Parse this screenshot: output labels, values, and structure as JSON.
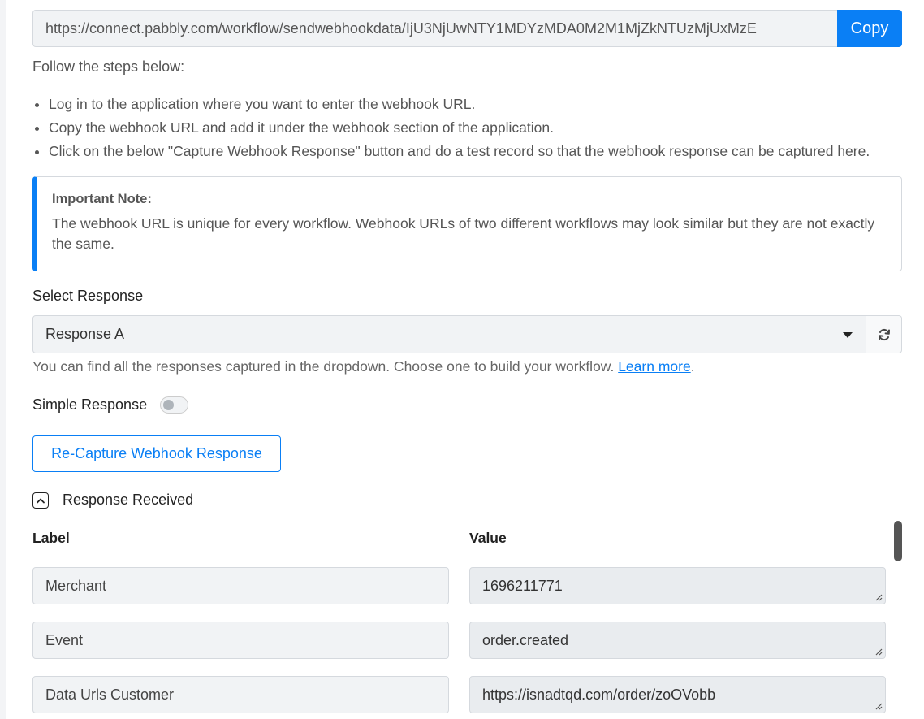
{
  "webhook": {
    "url": "https://connect.pabbly.com/workflow/sendwebhookdata/IjU3NjUwNTY1MDYzMDA0M2M1MjZkNTUzMjUxMzE",
    "copy_label": "Copy"
  },
  "steps": {
    "title": "Follow the steps below:",
    "items": [
      "Log in to the application where you want to enter the webhook URL.",
      "Copy the webhook URL and add it under the webhook section of the application.",
      "Click on the below \"Capture Webhook Response\" button and do a test record so that the webhook response can be captured here."
    ]
  },
  "note": {
    "title": "Important Note:",
    "body": "The webhook URL is unique for every workflow. Webhook URLs of two different workflows may look similar but they are not exactly the same."
  },
  "response_select": {
    "label": "Select Response",
    "selected": "Response A",
    "help_text": "You can find all the responses captured in the dropdown. Choose one to build your workflow. ",
    "learn_more": "Learn more",
    "help_suffix": "."
  },
  "simple_response": {
    "label": "Simple Response",
    "enabled": false
  },
  "recapture_label": "Re-Capture Webhook Response",
  "response_received": {
    "title": "Response Received",
    "label_header": "Label",
    "value_header": "Value",
    "rows": [
      {
        "label": "Merchant",
        "value": "1696211771"
      },
      {
        "label": "Event",
        "value": "order.created"
      },
      {
        "label": "Data Urls Customer",
        "value": "https://isnadtqd.com/order/zoOVobb"
      }
    ]
  },
  "colors": {
    "accent": "#0a7ff5",
    "field_bg": "#f1f3f5",
    "border": "#d5d9de"
  }
}
